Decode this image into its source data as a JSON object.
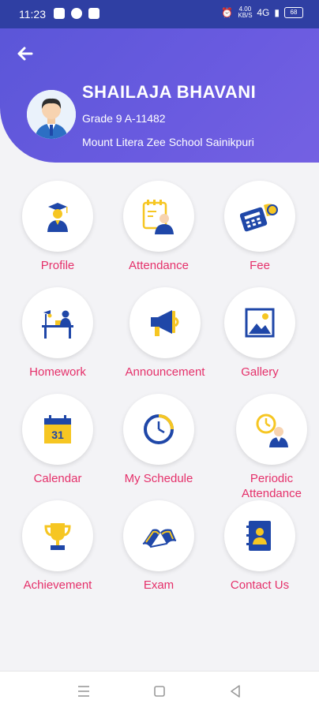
{
  "status_bar": {
    "time": "11:23",
    "network_speed": "4.00 KB/S",
    "network": "4G",
    "battery": "68"
  },
  "header": {
    "name": "SHAILAJA BHAVANI",
    "grade": "Grade 9 A-11482",
    "school": "Mount Litera Zee School Sainikpuri"
  },
  "menu": [
    {
      "label": "Profile",
      "icon": "graduate-icon"
    },
    {
      "label": "Attendance",
      "icon": "attendance-icon"
    },
    {
      "label": "Fee",
      "icon": "fee-icon"
    },
    {
      "label": "Homework",
      "icon": "homework-icon"
    },
    {
      "label": "Announcement",
      "icon": "megaphone-icon"
    },
    {
      "label": "Gallery",
      "icon": "gallery-icon"
    },
    {
      "label": "Calendar",
      "icon": "calendar-icon"
    },
    {
      "label": "My Schedule",
      "icon": "clock-icon"
    },
    {
      "label": "Periodic Attendance",
      "icon": "periodic-attendance-icon"
    },
    {
      "label": "Achievement",
      "icon": "trophy-icon"
    },
    {
      "label": "Exam",
      "icon": "book-icon"
    },
    {
      "label": "Contact Us",
      "icon": "contacts-book-icon"
    }
  ],
  "colors": {
    "header": "#6a5be0",
    "label": "#e5306a",
    "icon_blue": "#1f47a8",
    "icon_yellow": "#f6c622"
  }
}
